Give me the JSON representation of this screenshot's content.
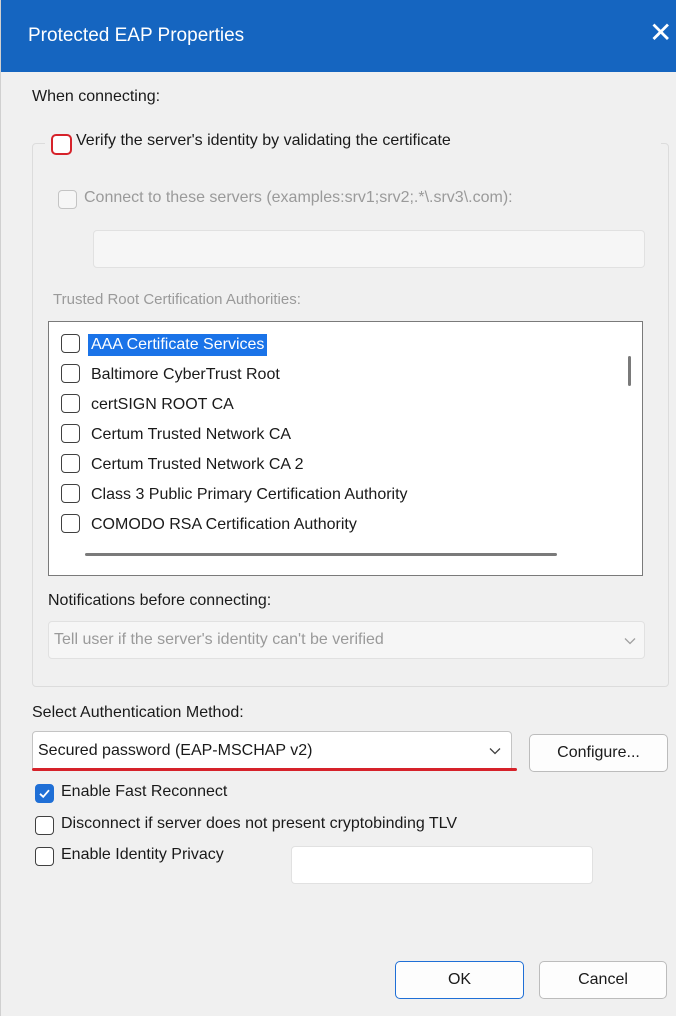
{
  "window": {
    "title": "Protected EAP Properties",
    "close_glyph": "✕"
  },
  "when_connecting_label": "When connecting:",
  "verify_server": {
    "label": "Verify the server's identity by validating the certificate",
    "checked": false,
    "highlight_color": "#d6222a"
  },
  "connect_servers": {
    "label": "Connect to these servers (examples:srv1;srv2;.*\\.srv3\\.com):",
    "checked": false,
    "enabled": false,
    "value": ""
  },
  "trusted_root": {
    "label": "Trusted Root Certification Authorities:",
    "items": [
      {
        "label": "AAA Certificate Services",
        "checked": false,
        "selected": true
      },
      {
        "label": "Baltimore CyberTrust Root",
        "checked": false,
        "selected": false
      },
      {
        "label": "certSIGN ROOT CA",
        "checked": false,
        "selected": false
      },
      {
        "label": "Certum Trusted Network CA",
        "checked": false,
        "selected": false
      },
      {
        "label": "Certum Trusted Network CA 2",
        "checked": false,
        "selected": false
      },
      {
        "label": "Class 3 Public Primary Certification Authority",
        "checked": false,
        "selected": false
      },
      {
        "label": "COMODO RSA Certification Authority",
        "checked": false,
        "selected": false
      }
    ]
  },
  "notifications": {
    "label": "Notifications before connecting:",
    "selected": "Tell user if the server's identity can't be verified",
    "enabled": false
  },
  "auth_method": {
    "label": "Select Authentication Method:",
    "selected": "Secured password (EAP-MSCHAP v2)",
    "configure_label": "Configure..."
  },
  "options": {
    "fast_reconnect": {
      "label": "Enable Fast Reconnect",
      "checked": true
    },
    "cryptobinding": {
      "label": "Disconnect if server does not present cryptobinding TLV",
      "checked": false
    },
    "identity_privacy": {
      "label": "Enable Identity Privacy",
      "checked": false,
      "value": ""
    }
  },
  "buttons": {
    "ok": "OK",
    "cancel": "Cancel"
  },
  "colors": {
    "title_bar": "#1565c0",
    "accent": "#1f6fd6",
    "selection": "#1a73e8",
    "annotation_red": "#d6222a"
  }
}
